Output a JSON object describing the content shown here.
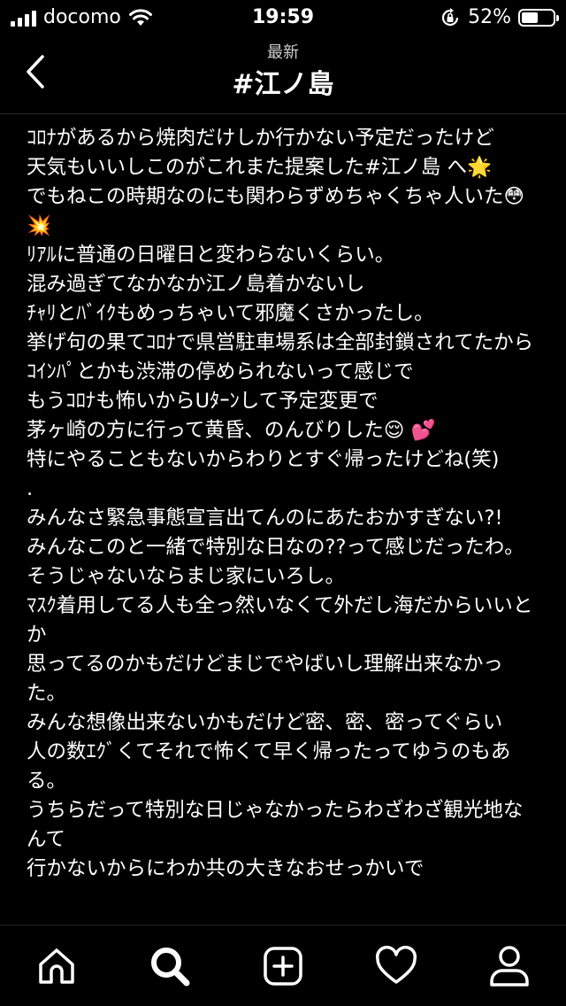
{
  "status_bar": {
    "carrier": "docomo",
    "time": "19:59",
    "battery_percent": "52%",
    "battery_level": 0.52,
    "icons": [
      "signal-icon",
      "wifi-icon",
      "rotation-lock-icon",
      "battery-icon"
    ]
  },
  "header": {
    "subtitle": "最新",
    "title": "#江ノ島"
  },
  "post": {
    "lines": [
      "ｺﾛﾅがあるから焼肉だけしか行かない予定だったけど",
      "天気もいいしこのがこれまた提案した#江ノ島 へ🌟",
      "でもねこの時期なのにも関わらずめちゃくちゃ人いた😳 💥",
      "ﾘｱﾙに普通の日曜日と変わらないくらい。",
      "混み過ぎてなかなか江ノ島着かないし",
      "ﾁｬﾘとﾊﾞｲｸもめっちゃいて邪魔くさかったし。",
      "挙げ句の果てｺﾛﾅで県営駐車場系は全部封鎖されてたから",
      "ｺｲﾝﾊﾟとかも渋滞の停められないって感じで",
      "もうｺﾛﾅも怖いからUﾀｰﾝして予定変更で",
      "茅ヶ崎の方に行って黄昏、のんびりした😌 💕",
      "特にやることもないからわりとすぐ帰ったけどね(笑)",
      ".",
      "みんなさ緊急事態宣言出てんのにあたおかすぎない?!",
      "みんなこのと一緒で特別な日なの??って感じだったわ。",
      "そうじゃないならまじ家にいろし。",
      "ﾏｽｸ着用してる人も全っ然いなくて外だし海だからいいとか",
      "思ってるのかもだけどまじでやばいし理解出来なかった。",
      "みんな想像出来ないかもだけど密、密、密ってぐらい",
      "人の数ｴｸﾞくてそれで怖くて早く帰ったってゆうのもある。",
      "うちらだって特別な日じゃなかったらわざわざ観光地なんて",
      "行かないからにわか共の大きなおせっかいで"
    ]
  },
  "tab_bar": {
    "tabs": [
      {
        "name": "home",
        "icon": "home-icon"
      },
      {
        "name": "search",
        "icon": "search-icon",
        "active": true
      },
      {
        "name": "new-post",
        "icon": "add-post-icon"
      },
      {
        "name": "activity",
        "icon": "heart-icon"
      },
      {
        "name": "profile",
        "icon": "profile-icon"
      }
    ]
  }
}
